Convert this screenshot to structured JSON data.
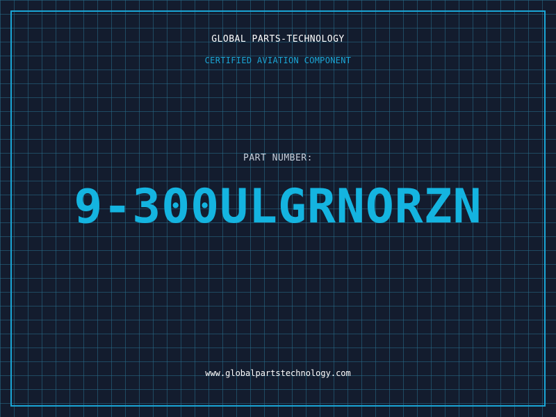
{
  "header": {
    "brand": "GLOBAL PARTS-TECHNOLOGY",
    "subtitle": "CERTIFIED AVIATION COMPONENT"
  },
  "part": {
    "label": "PART NUMBER:",
    "number": "9-300ULGRNORZN"
  },
  "footer": {
    "website": "www.globalpartstechnology.com"
  },
  "colors": {
    "background": "#131c2e",
    "grid": "#286e8c",
    "accent": "#1aa6d6",
    "part_number": "#14b4e0",
    "text": "#ffffff"
  }
}
